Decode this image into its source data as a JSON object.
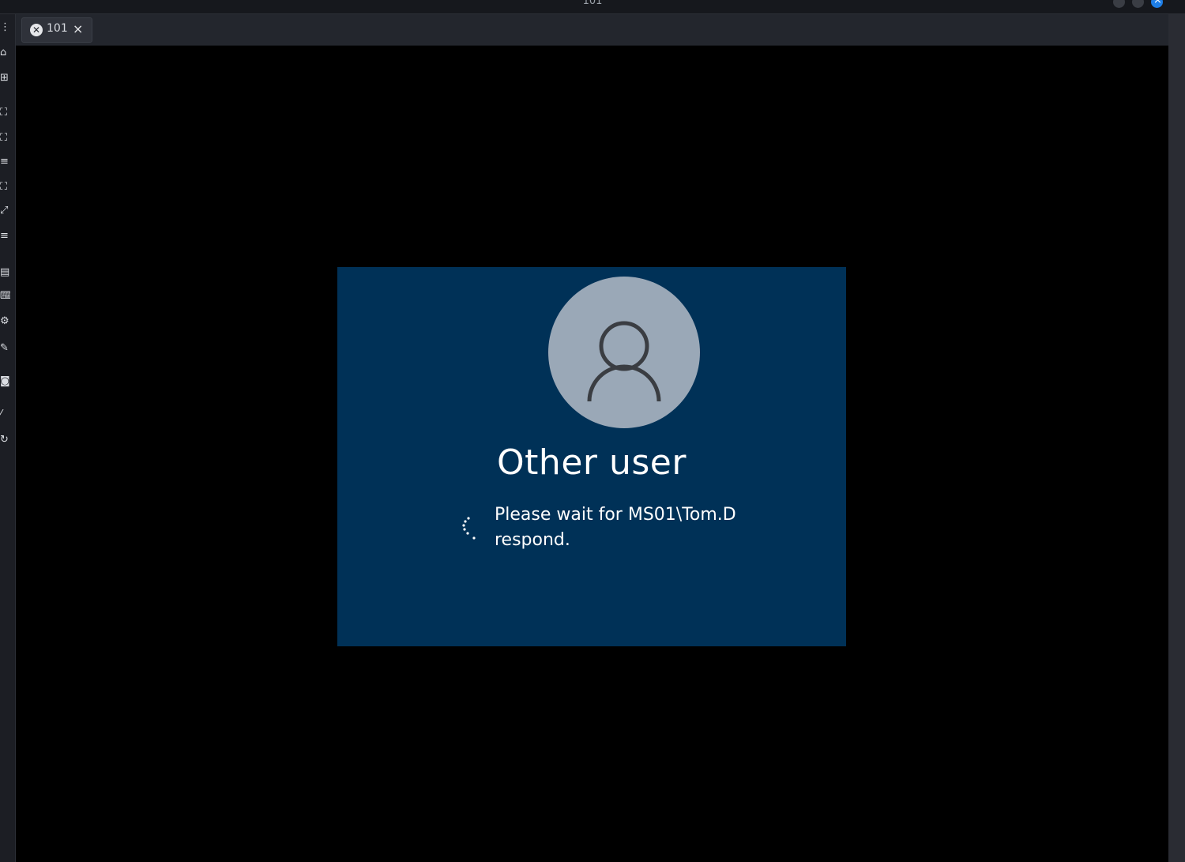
{
  "window": {
    "title": "101"
  },
  "tab": {
    "label": "101",
    "close": "×",
    "icon": "vm-icon"
  },
  "toolbar": {
    "icons": [
      "grip-icon",
      "home-icon",
      "new-window-icon",
      "fullscreen-icon",
      "fit-window-icon",
      "menu-icon",
      "shrink-icon",
      "expand-icon",
      "menu-icon-2",
      "printer-icon",
      "keyboard-icon",
      "settings-icon",
      "tools-icon",
      "camera-icon",
      "pen-icon",
      "refresh-icon"
    ]
  },
  "login": {
    "username": "Other user",
    "message": "Please wait for MS01\\Tom.D respond.",
    "panel_color": "#003157",
    "avatar_color": "#9aa8b7"
  }
}
